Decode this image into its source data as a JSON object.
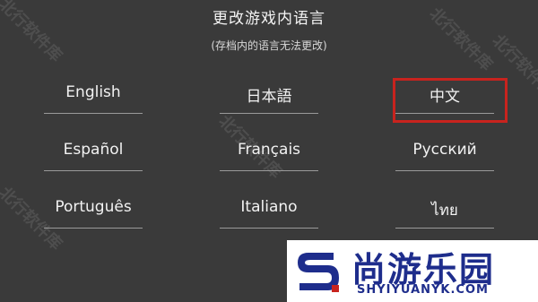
{
  "title": "更改游戏内语言",
  "subtitle": "(存档内的语言无法更改)",
  "languages": [
    {
      "label": "English"
    },
    {
      "label": "日本語"
    },
    {
      "label": "中文"
    },
    {
      "label": "Español"
    },
    {
      "label": "Français"
    },
    {
      "label": "Русский"
    },
    {
      "label": "Português"
    },
    {
      "label": "Italiano"
    },
    {
      "label": "ไทย"
    }
  ],
  "selected_language": "中文",
  "watermark": "北行软件库",
  "logo": {
    "cn": "尚游乐园",
    "en": "SHYIYUANYK.COM",
    "brand_color": "#1e2d8c",
    "accent_color": "#c8231e"
  },
  "colors": {
    "background": "#3a3a3a",
    "highlight": "#c8231e"
  }
}
